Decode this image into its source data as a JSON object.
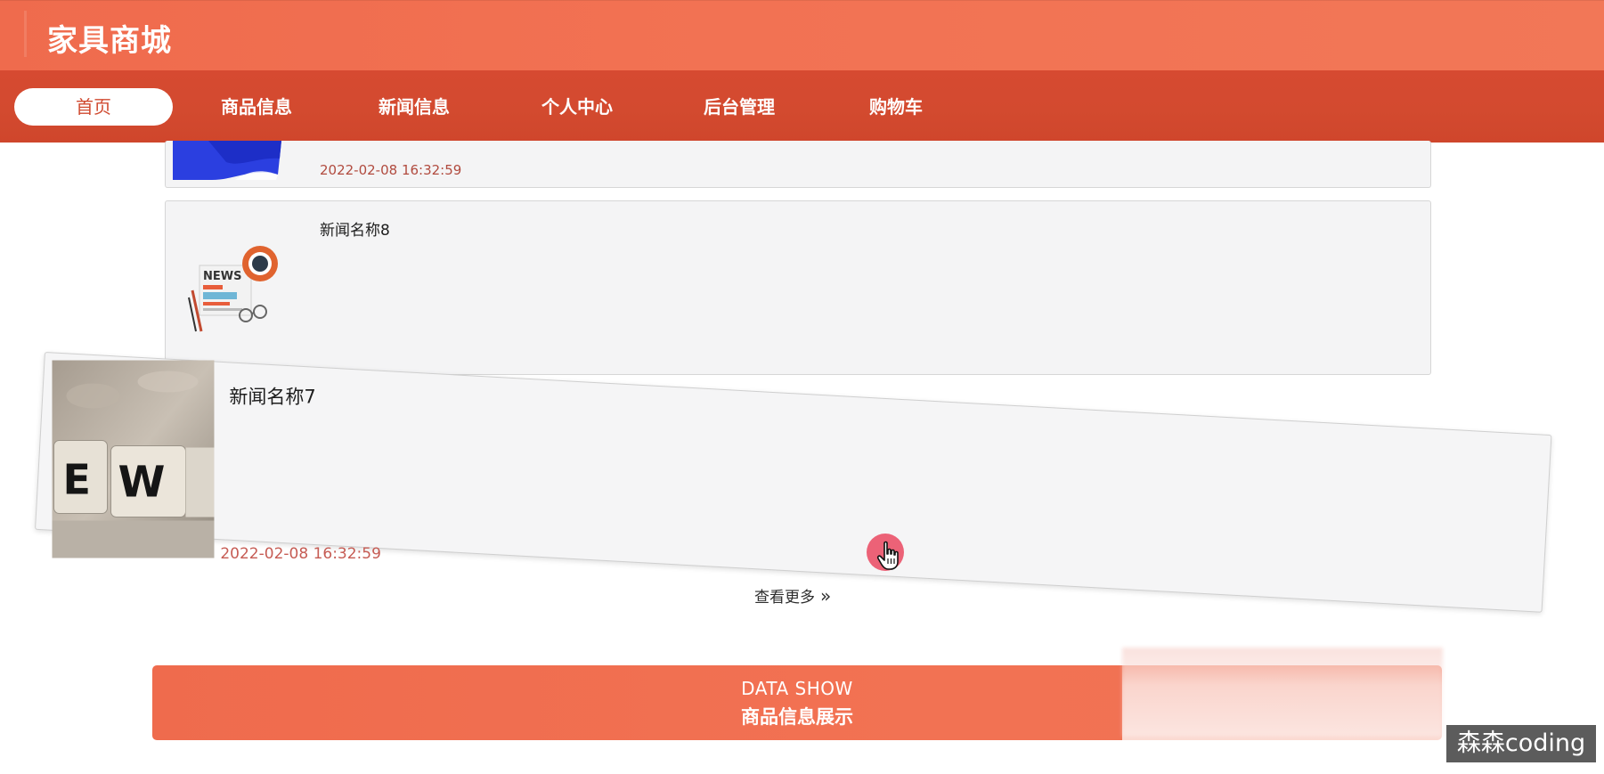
{
  "header": {
    "site_title": "家具商城"
  },
  "nav": {
    "items": [
      {
        "label": "首页"
      },
      {
        "label": "商品信息"
      },
      {
        "label": "新闻信息"
      },
      {
        "label": "个人中心"
      },
      {
        "label": "后台管理"
      },
      {
        "label": "购物车"
      }
    ]
  },
  "news": {
    "items": [
      {
        "title": "",
        "date": "2022-02-08 16:32:59"
      },
      {
        "title": "新闻名称8",
        "date": ""
      },
      {
        "title": "新闻名称7",
        "date": "2022-02-08 16:32:59"
      }
    ],
    "more_label": "查看更多"
  },
  "section": {
    "english": "DATA SHOW",
    "chinese": "商品信息展示"
  },
  "watermark": "森森coding",
  "colors": {
    "header_bg": "#f27253",
    "nav_bg": "#d34a2f",
    "active_nav_text": "#d04a30",
    "date_text": "#b14b3f"
  }
}
